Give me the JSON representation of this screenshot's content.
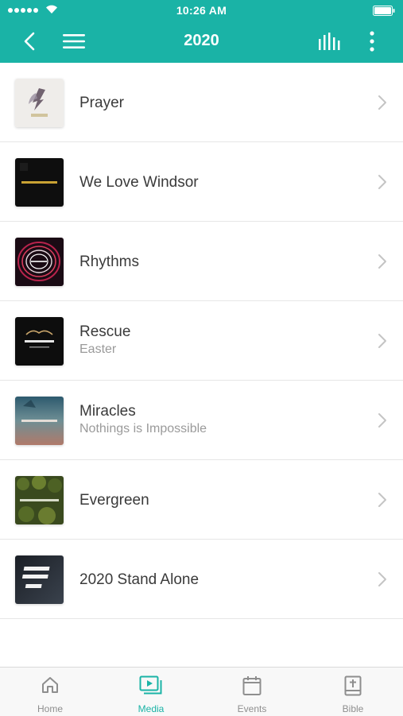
{
  "status_bar": {
    "time": "10:26 AM"
  },
  "nav": {
    "title": "2020"
  },
  "colors": {
    "accent": "#1ab3a6",
    "header_text": "#ffffff",
    "subtitle": "#9a9a9a",
    "tab_inactive": "#8e8e8e"
  },
  "series": [
    {
      "title": "Prayer",
      "subtitle": "",
      "thumb_icon": "prayer-artwork"
    },
    {
      "title": "We Love Windsor",
      "subtitle": "",
      "thumb_icon": "we-love-windsor-artwork"
    },
    {
      "title": "Rhythms",
      "subtitle": "",
      "thumb_icon": "rhythms-artwork"
    },
    {
      "title": "Rescue",
      "subtitle": "Easter",
      "thumb_icon": "rescue-artwork"
    },
    {
      "title": "Miracles",
      "subtitle": "Nothings is Impossible",
      "thumb_icon": "miracles-artwork"
    },
    {
      "title": "Evergreen",
      "subtitle": "",
      "thumb_icon": "evergreen-artwork"
    },
    {
      "title": "2020 Stand Alone",
      "subtitle": "",
      "thumb_icon": "stand-alone-sermons-artwork"
    }
  ],
  "tabs": [
    {
      "label": "Home",
      "icon": "home-icon",
      "active": false
    },
    {
      "label": "Media",
      "icon": "media-icon",
      "active": true
    },
    {
      "label": "Events",
      "icon": "calendar-icon",
      "active": false
    },
    {
      "label": "Bible",
      "icon": "bible-icon",
      "active": false
    }
  ]
}
